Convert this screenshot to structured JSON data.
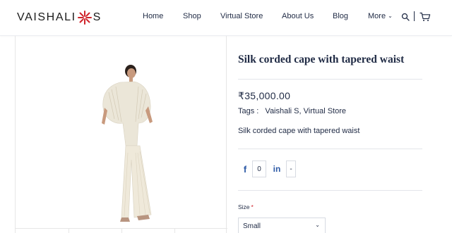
{
  "brand": {
    "logo_left": "VAISHALI",
    "logo_right": "S",
    "accent": "#d0242b"
  },
  "nav": {
    "items": [
      {
        "label": "Home"
      },
      {
        "label": "Shop"
      },
      {
        "label": "Virtual Store"
      },
      {
        "label": "About Us"
      },
      {
        "label": "Blog"
      },
      {
        "label": "More"
      }
    ],
    "icons": {
      "search": "search-icon",
      "cart": "cart-icon"
    }
  },
  "product": {
    "title": "Silk corded cape with tapered waist",
    "price": "₹35,000.00",
    "tags_label": "Tags :",
    "tags": [
      "Vaishali S",
      "Virtual Store"
    ],
    "tags_sep": ", ",
    "description": "Silk corded cape with tapered waist"
  },
  "share": {
    "facebook_icon": "f",
    "facebook_count": "0",
    "linkedin_icon": "in",
    "linkedin_count": "-"
  },
  "size": {
    "label": "Size",
    "required_mark": "*",
    "selected": "Small"
  },
  "colors": {
    "text": "#1f2a44",
    "link": "#2d5aa6",
    "required": "#d0242b"
  }
}
